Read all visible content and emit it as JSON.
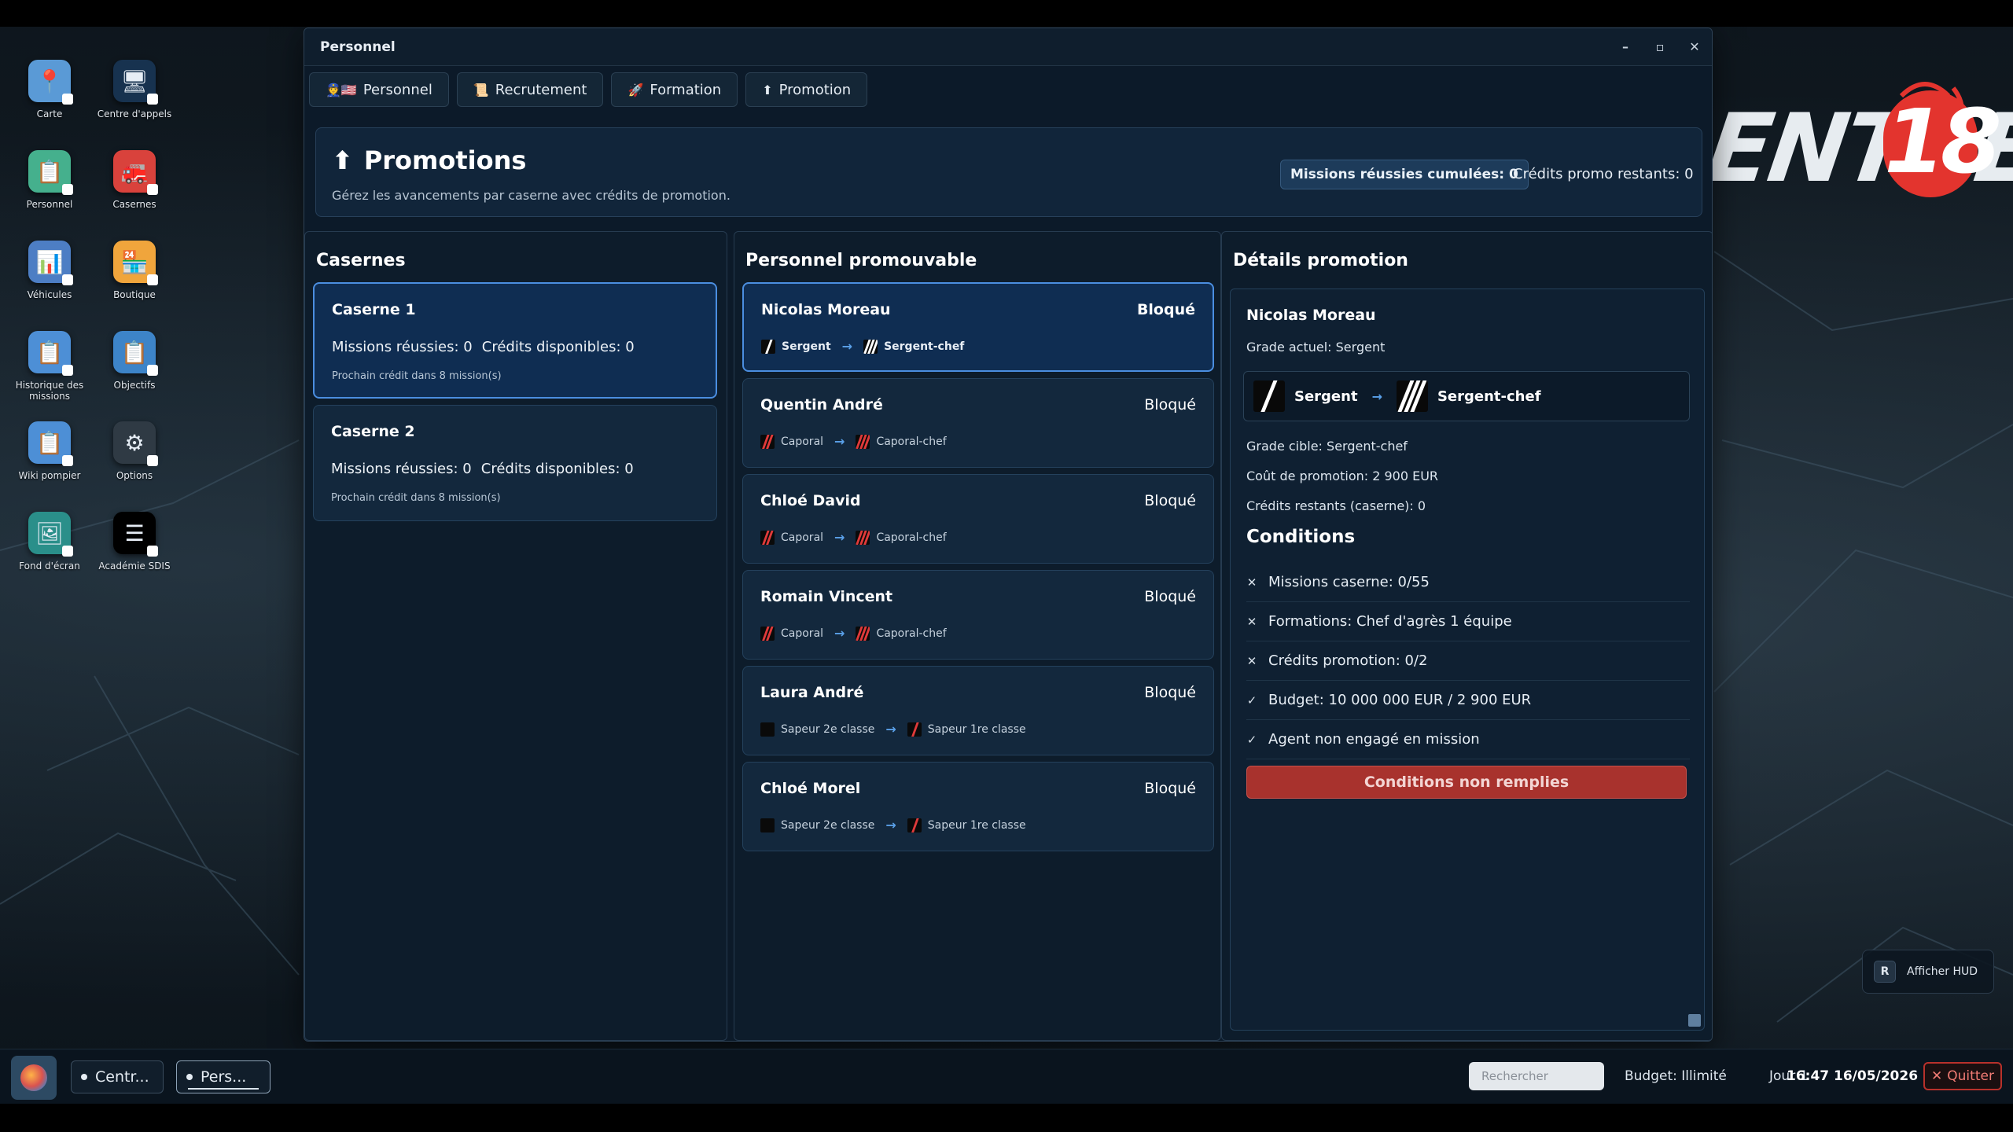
{
  "desktop": {
    "icons": [
      {
        "label": "Carte",
        "icon": "map-icon",
        "color": "#5a9ad6"
      },
      {
        "label": "Centre d'appels",
        "icon": "call-center-icon",
        "color": "#17324f"
      },
      {
        "label": "Personnel",
        "icon": "personnel-icon",
        "color": "#45b08d"
      },
      {
        "label": "Casernes",
        "icon": "fire-station-icon",
        "color": "#d9423c"
      },
      {
        "label": "Véhicules",
        "icon": "vehicles-icon",
        "color": "#4d7ec4"
      },
      {
        "label": "Boutique",
        "icon": "shop-icon",
        "color": "#f0a53c"
      },
      {
        "label": "Historique des missions",
        "icon": "mission-history-icon",
        "color": "#4d8fd6"
      },
      {
        "label": "Objectifs",
        "icon": "objectives-icon",
        "color": "#3d84c8"
      },
      {
        "label": "Wiki pompier",
        "icon": "wiki-icon",
        "color": "#4d8fd6"
      },
      {
        "label": "Options",
        "icon": "gear-icon",
        "color": "#2f3a44"
      },
      {
        "label": "Fond d'écran",
        "icon": "wallpaper-icon",
        "color": "#2a8f8a"
      },
      {
        "label": "Académie SDIS",
        "icon": "academy-icon",
        "color": "#000000"
      }
    ],
    "logo": {
      "text": "ENTRE",
      "number": "18"
    },
    "hud_button": {
      "key": "R",
      "label": "Afficher HUD"
    }
  },
  "window": {
    "title": "Personnel",
    "controls": {
      "minimize": "–",
      "maximize": "▫",
      "close": "✕"
    },
    "tabs": [
      {
        "label": "Personnel",
        "icon": "👮🇺🇸"
      },
      {
        "label": "Recrutement",
        "icon": "📜"
      },
      {
        "label": "Formation",
        "icon": "🚀"
      },
      {
        "label": "Promotion",
        "icon": "⬆"
      }
    ],
    "header": {
      "icon": "⬆",
      "title": "Promotions",
      "subtitle": "Gérez les avancements par caserne avec crédits de promotion.",
      "missions_pill": "Missions réussies cumulées: 0",
      "credits_rest": "Crédits promo restants: 0"
    },
    "casernes": {
      "title": "Casernes",
      "items": [
        {
          "name": "Caserne 1",
          "missions": "Missions réussies: 0",
          "credits": "Crédits disponibles: 0",
          "next": "Prochain crédit dans 8 mission(s)",
          "selected": true
        },
        {
          "name": "Caserne 2",
          "missions": "Missions réussies: 0",
          "credits": "Crédits disponibles: 0",
          "next": "Prochain crédit dans 8 mission(s)",
          "selected": false
        }
      ]
    },
    "promouvable": {
      "title": "Personnel promouvable",
      "items": [
        {
          "name": "Nicolas Moreau",
          "status": "Bloqué",
          "from": "Sergent",
          "to": "Sergent-chef",
          "selected": true
        },
        {
          "name": "Quentin André",
          "status": "Bloqué",
          "from": "Caporal",
          "to": "Caporal-chef",
          "selected": false
        },
        {
          "name": "Chloé David",
          "status": "Bloqué",
          "from": "Caporal",
          "to": "Caporal-chef",
          "selected": false
        },
        {
          "name": "Romain Vincent",
          "status": "Bloqué",
          "from": "Caporal",
          "to": "Caporal-chef",
          "selected": false
        },
        {
          "name": "Laura André",
          "status": "Bloqué",
          "from": "Sapeur 2e classe",
          "to": "Sapeur 1re classe",
          "selected": false
        },
        {
          "name": "Chloé Morel",
          "status": "Bloqué",
          "from": "Sapeur 2e classe",
          "to": "Sapeur 1re classe",
          "selected": false
        }
      ]
    },
    "details": {
      "title": "Détails promotion",
      "name": "Nicolas Moreau",
      "grade_actuel": "Grade actuel: Sergent",
      "from": "Sergent",
      "to": "Sergent-chef",
      "grade_cible": "Grade cible: Sergent-chef",
      "cout": "Coût de promotion: 2 900 EUR",
      "credits_restants": "Crédits restants (caserne): 0",
      "conditions_title": "Conditions",
      "conditions": [
        {
          "mark": "✕",
          "text": "Missions caserne: 0/55"
        },
        {
          "mark": "✕",
          "text": "Formations: Chef d'agrès 1 équipe"
        },
        {
          "mark": "✕",
          "text": "Crédits promotion: 0/2"
        },
        {
          "mark": "✓",
          "text": "Budget: 10 000 000 EUR / 2 900 EUR"
        },
        {
          "mark": "✓",
          "text": "Agent non engagé en mission"
        }
      ],
      "button": "Conditions non remplies"
    }
  },
  "taskbar": {
    "items": [
      {
        "label": "Centr..."
      },
      {
        "label": "Pers..."
      }
    ],
    "search_placeholder": "Rechercher",
    "budget": "Budget: Illimité",
    "jour": "Jour 1",
    "time": "16:47",
    "date": "16/05/2026",
    "quit": "Quitter",
    "quit_icon": "✕"
  }
}
